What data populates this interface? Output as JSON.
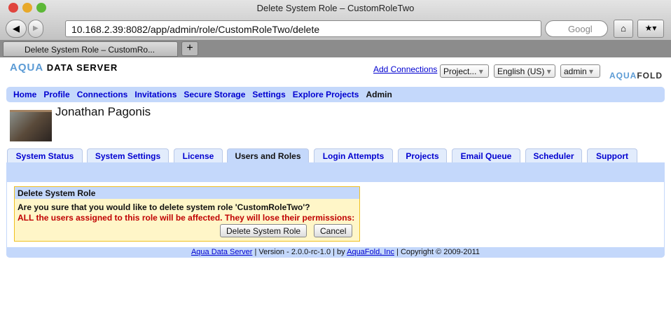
{
  "browser": {
    "window_title": "Delete System Role – CustomRoleTwo",
    "url": "10.168.2.39:8082/app/admin/role/CustomRoleTwo/delete",
    "search_placeholder": "Googl",
    "tab_title": "Delete System Role – CustomRo..."
  },
  "header": {
    "logo_text": "AQUA DATA SERVER",
    "add_connections": "Add Connections",
    "project_select": "Project...",
    "language_select": "English (US)",
    "user_select": "admin",
    "brand_logo": "AQUAFOLD"
  },
  "nav": {
    "items": [
      "Home",
      "Profile",
      "Connections",
      "Invitations",
      "Secure Storage",
      "Settings",
      "Explore Projects"
    ],
    "current": "Admin"
  },
  "user": {
    "name": "Jonathan Pagonis"
  },
  "tabs": [
    "System Status",
    "System Settings",
    "License",
    "Users and Roles",
    "Login Attempts",
    "Projects",
    "Email Queue",
    "Scheduler",
    "Support"
  ],
  "active_tab": "Users and Roles",
  "dialog": {
    "title": "Delete System Role",
    "question": "Are you sure that you would like to delete system role 'CustomRoleTwo'?",
    "warning": "ALL the users assigned to this role will be affected. They will lose their permissions:",
    "delete_label": "Delete System Role",
    "cancel_label": "Cancel"
  },
  "footer": {
    "product_link": "Aqua Data Server",
    "version": " | Version - 2.0.0-rc-1.0 | by ",
    "company_link": "AquaFold, Inc",
    "copyright": " | Copyright © 2009-2011"
  }
}
